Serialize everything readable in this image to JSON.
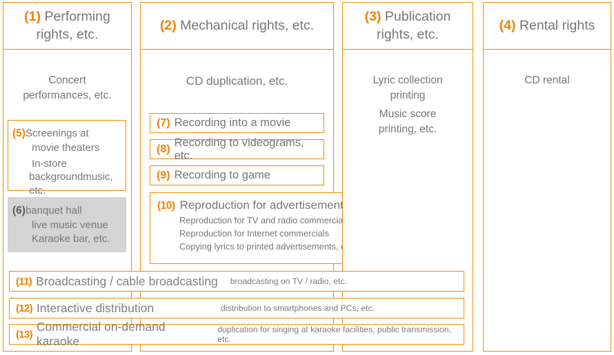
{
  "theme": {
    "accent": "#ED8B00",
    "number_color": "#F08300",
    "text_color": "#767676",
    "highlight_fill": "#d4d4d4",
    "background": "#ffffff"
  },
  "columns": [
    {
      "number": "(1)",
      "title": "Performing rights, etc.",
      "title_line1": "Performing",
      "title_line2": "rights, etc.",
      "lead_line1": "Concert",
      "lead_line2": "performances, etc."
    },
    {
      "number": "(2)",
      "title": "Mechanical rights, etc.",
      "title_line1": "Mechanical rights, etc.",
      "title_line2": "",
      "lead_line1": "CD duplication, etc.",
      "lead_line2": ""
    },
    {
      "number": "(3)",
      "title": "Publication rights, etc.",
      "title_line1": "Publication",
      "title_line2": "rights, etc.",
      "lead_line1": "Lyric collection printing",
      "lead_line2": "Music score printing, etc."
    },
    {
      "number": "(4)",
      "title": "Rental rights",
      "title_line1": "Rental rights",
      "title_line2": "",
      "lead_line1": "CD rental",
      "lead_line2": ""
    }
  ],
  "col3_lead": {
    "group1_line1": "Lyric collection",
    "group1_line2": "printing",
    "group2_line1": "Music score",
    "group2_line2": "printing, etc."
  },
  "item5": {
    "number": "(5)",
    "line1": "Screenings at",
    "line2": "movie theaters",
    "line3": "In-store",
    "line4": "backgroundmusic, etc."
  },
  "item6": {
    "number": "(6)",
    "line1": "banquet hall",
    "line2": "live music venue",
    "line3": "Karaoke bar, etc."
  },
  "items": [
    {
      "number": "(7)",
      "label": "Recording into a movie"
    },
    {
      "number": "(8)",
      "label": "Recording to videograms, etc."
    },
    {
      "number": "(9)",
      "label": "Recording to game"
    }
  ],
  "item10": {
    "number": "(10)",
    "label": "Reproduction for advertisements",
    "lines": [
      "Reproduction for TV and radio commercials",
      "Reproduction for Internet commercials",
      "Copying lyrics to printed advertisements, etc."
    ]
  },
  "bars": [
    {
      "number": "(11)",
      "label": "Broadcasting / cable broadcasting",
      "note": "broadcasting on TV / radio, etc.",
      "label_size": "17.5px"
    },
    {
      "number": "(12)",
      "label": "Interactive distribution",
      "note": "distribution to smartphones and PCs, etc.",
      "label_size": "17.5px"
    },
    {
      "number": "(13)",
      "label": "Commercial on-demand karaoke",
      "note": "duplication for singing at karaoke facilities, public transmission, etc.",
      "label_size": "17.5px"
    }
  ]
}
